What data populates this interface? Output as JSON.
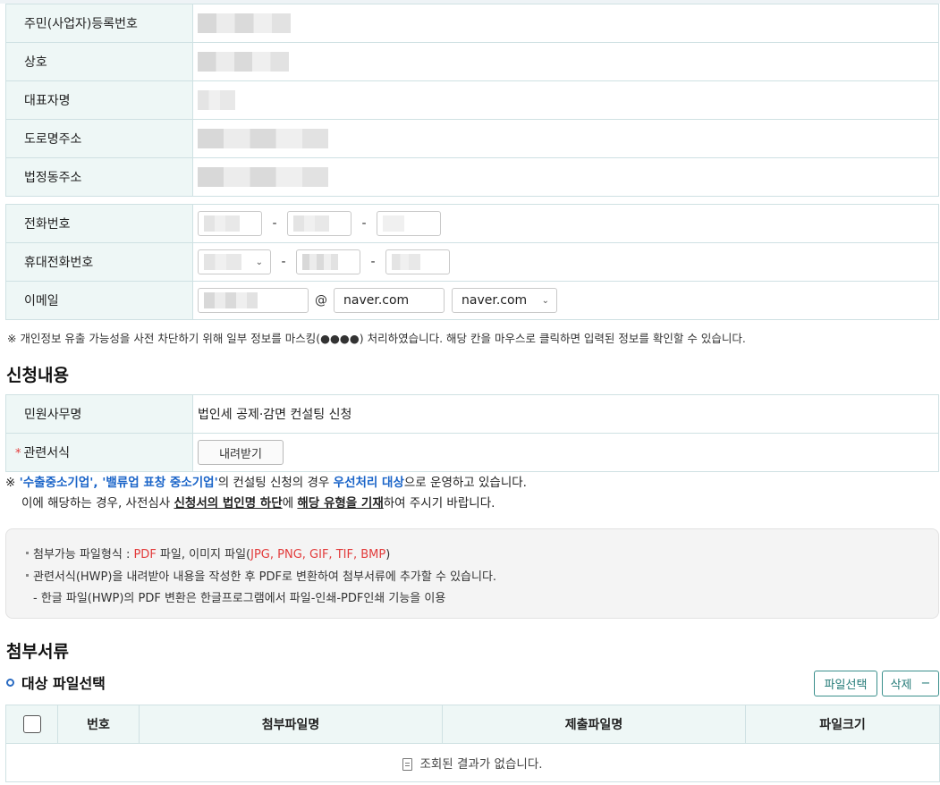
{
  "applicant": {
    "rows": [
      {
        "label": "주민(사업자)등록번호"
      },
      {
        "label": "상호"
      },
      {
        "label": "대표자명"
      },
      {
        "label": "도로명주소"
      },
      {
        "label": "법정동주소"
      }
    ]
  },
  "contact": {
    "phone_label": "전화번호",
    "mobile_label": "휴대전화번호",
    "email_label": "이메일",
    "dash": "-",
    "at": "@",
    "email_domain_value": "naver.com",
    "email_domain_select": "naver.com"
  },
  "notice_mask": "※ 개인정보 유출 가능성을 사전 차단하기 위해 일부 정보를 마스킹(●●●●) 처리하였습니다. 해당 칸을 마우스로 클릭하면 입력된 정보를 확인할 수 있습니다.",
  "application": {
    "section_title": "신청내용",
    "service_label": "민원사무명",
    "service_value": "법인세 공제·감면 컨설팅 신청",
    "forms_label": "관련서식",
    "required_mark": "*",
    "download_label": "내려받기"
  },
  "priority_notice": {
    "prefix": "※ ",
    "company1": "'수출중소기업'",
    "comma": ", ",
    "company2": "'밸류업 표창 중소기업'",
    "mid": "의 컨설팅 신청의 경우 ",
    "priority": "우선처리 대상",
    "suffix": "으로 운영하고 있습니다.",
    "l2_a": "이에 해당하는 경우, 사전심사 ",
    "l2_b": "신청서의 법인명 하단",
    "l2_c": "에 ",
    "l2_d": "해당 유형을 기재",
    "l2_e": "하여 주시기 바랍니다."
  },
  "info": {
    "l1_a": "첨부가능 파일형식 : ",
    "l1_pdf": "PDF",
    "l1_b": " 파일, 이미지 파일(",
    "l1_img": "JPG, PNG, GIF, TIF, BMP",
    "l1_c": ")",
    "l2": "관련서식(HWP)을 내려받아 내용을 작성한 후 PDF로 변환하여 첨부서류에 추가할 수 있습니다.",
    "l3": "- 한글 파일(HWP)의 PDF 변환은 한글프로그램에서 파일-인쇄-PDF인쇄 기능을 이용"
  },
  "attachments": {
    "section_title": "첨부서류",
    "subtitle": "대상 파일선택",
    "select_button": "파일선택",
    "delete_button": "삭제",
    "delete_symbol": "−",
    "columns": [
      "번호",
      "첨부파일명",
      "제출파일명",
      "파일크기"
    ],
    "empty_message": "조회된 결과가 없습니다."
  },
  "colors": {
    "header_bg": "#eef7f6",
    "border": "#cfe1e3",
    "accent_blue": "#1a64c8",
    "accent_red": "#e23b3b",
    "teal": "#237a77"
  }
}
